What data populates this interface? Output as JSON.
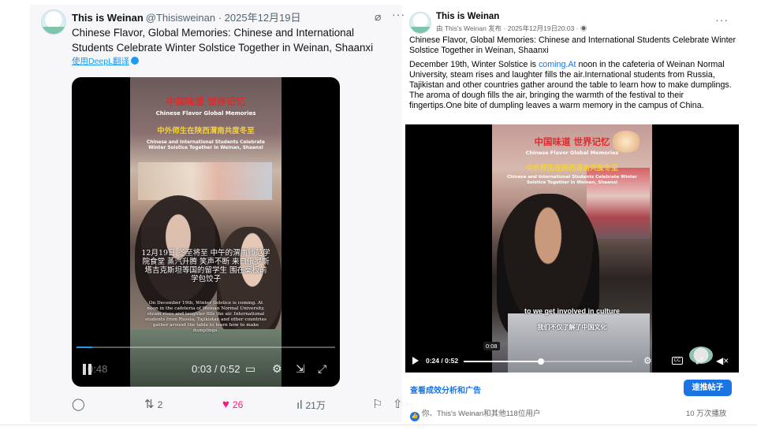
{
  "x_post": {
    "name": "This is Weinan",
    "handle_date": "@Thisisweinan · 2025年12月19日",
    "text": "Chinese Flavor, Global Memories: Chinese and International Students Celebrate Winter Solstice Together in Weinan, Shaanxi",
    "translate_label": "使用DeepL翻译",
    "video": {
      "overlay_title_cn": "中国味道 世界记忆",
      "overlay_title_en": "Chinese Flavor  Global Memories",
      "overlay_subtitle_cn": "中外师生在陕西渭南共度冬至",
      "overlay_subtitle_en": "Chinese and International Students Celebrate Winter Solstice Together in Weinan, Shaanxi",
      "caption_cn": "12月19日 冬至将至 中午的渭南师范学院食堂 蒸汽升腾 笑声不断 来自俄罗斯 塔吉克斯坦等国的留学生 围在案板前学包饺子",
      "caption_en": "On December 19th, Winter Solstice is coming. At noon in the cafeteria of Weinan Normal University, steam rises and laughter fills the air. International students from Russia, Tajikistan and other countries gather around the table to learn how to make dumplings.",
      "ghost_time": "0:48",
      "time": "0:03 / 0:52",
      "progress": 0.06
    },
    "actions": {
      "replies": "",
      "reposts": "2",
      "likes": "26",
      "views": "21万"
    }
  },
  "fb_post": {
    "name": "This is Weinan",
    "meta": "由 This's Weinan 发布 · 2025年12月19日20:03 ·",
    "title": "Chinese Flavor, Global Memories: Chinese and International Students Celebrate Winter Solstice Together in Weinan, Shaanxi",
    "para1_before": "December 19th, Winter Solstice is ",
    "para1_link": "coming.At",
    "para1_after": " noon in the cafeteria of Weinan Normal University, steam rises and laughter fills the air.International students from Russia, Tajikistan and other countries gather around the table to learn how to make dumplings.",
    "para2": "The aroma of dough fills the air, bringing the warmth of the festival to their fingertips.One bite of dumpling leaves a warm memory in the campus of China.",
    "video": {
      "overlay_title_cn": "中国味道 世界记忆",
      "overlay_title_en": "Chinese Flavor  Global Memories",
      "overlay_subtitle_cn": "中外师生在陕西渭南共度冬至",
      "overlay_subtitle_en": "Chinese and International Students Celebrate Winter Solstice Together in Weinan, Shaanxi",
      "caption_en": "to we get involved in culture",
      "caption_cn": "我们不仅了解了中国文化",
      "hover_time": "0:08",
      "time": "0:24 / 0:52",
      "progress": 0.46,
      "cc_label": "CC"
    },
    "insights_label": "查看成效分析和广告",
    "boost_label": "速推帖子",
    "reactions": "你、This's Weinan和其他118位用户",
    "views": "10 万次播放"
  }
}
